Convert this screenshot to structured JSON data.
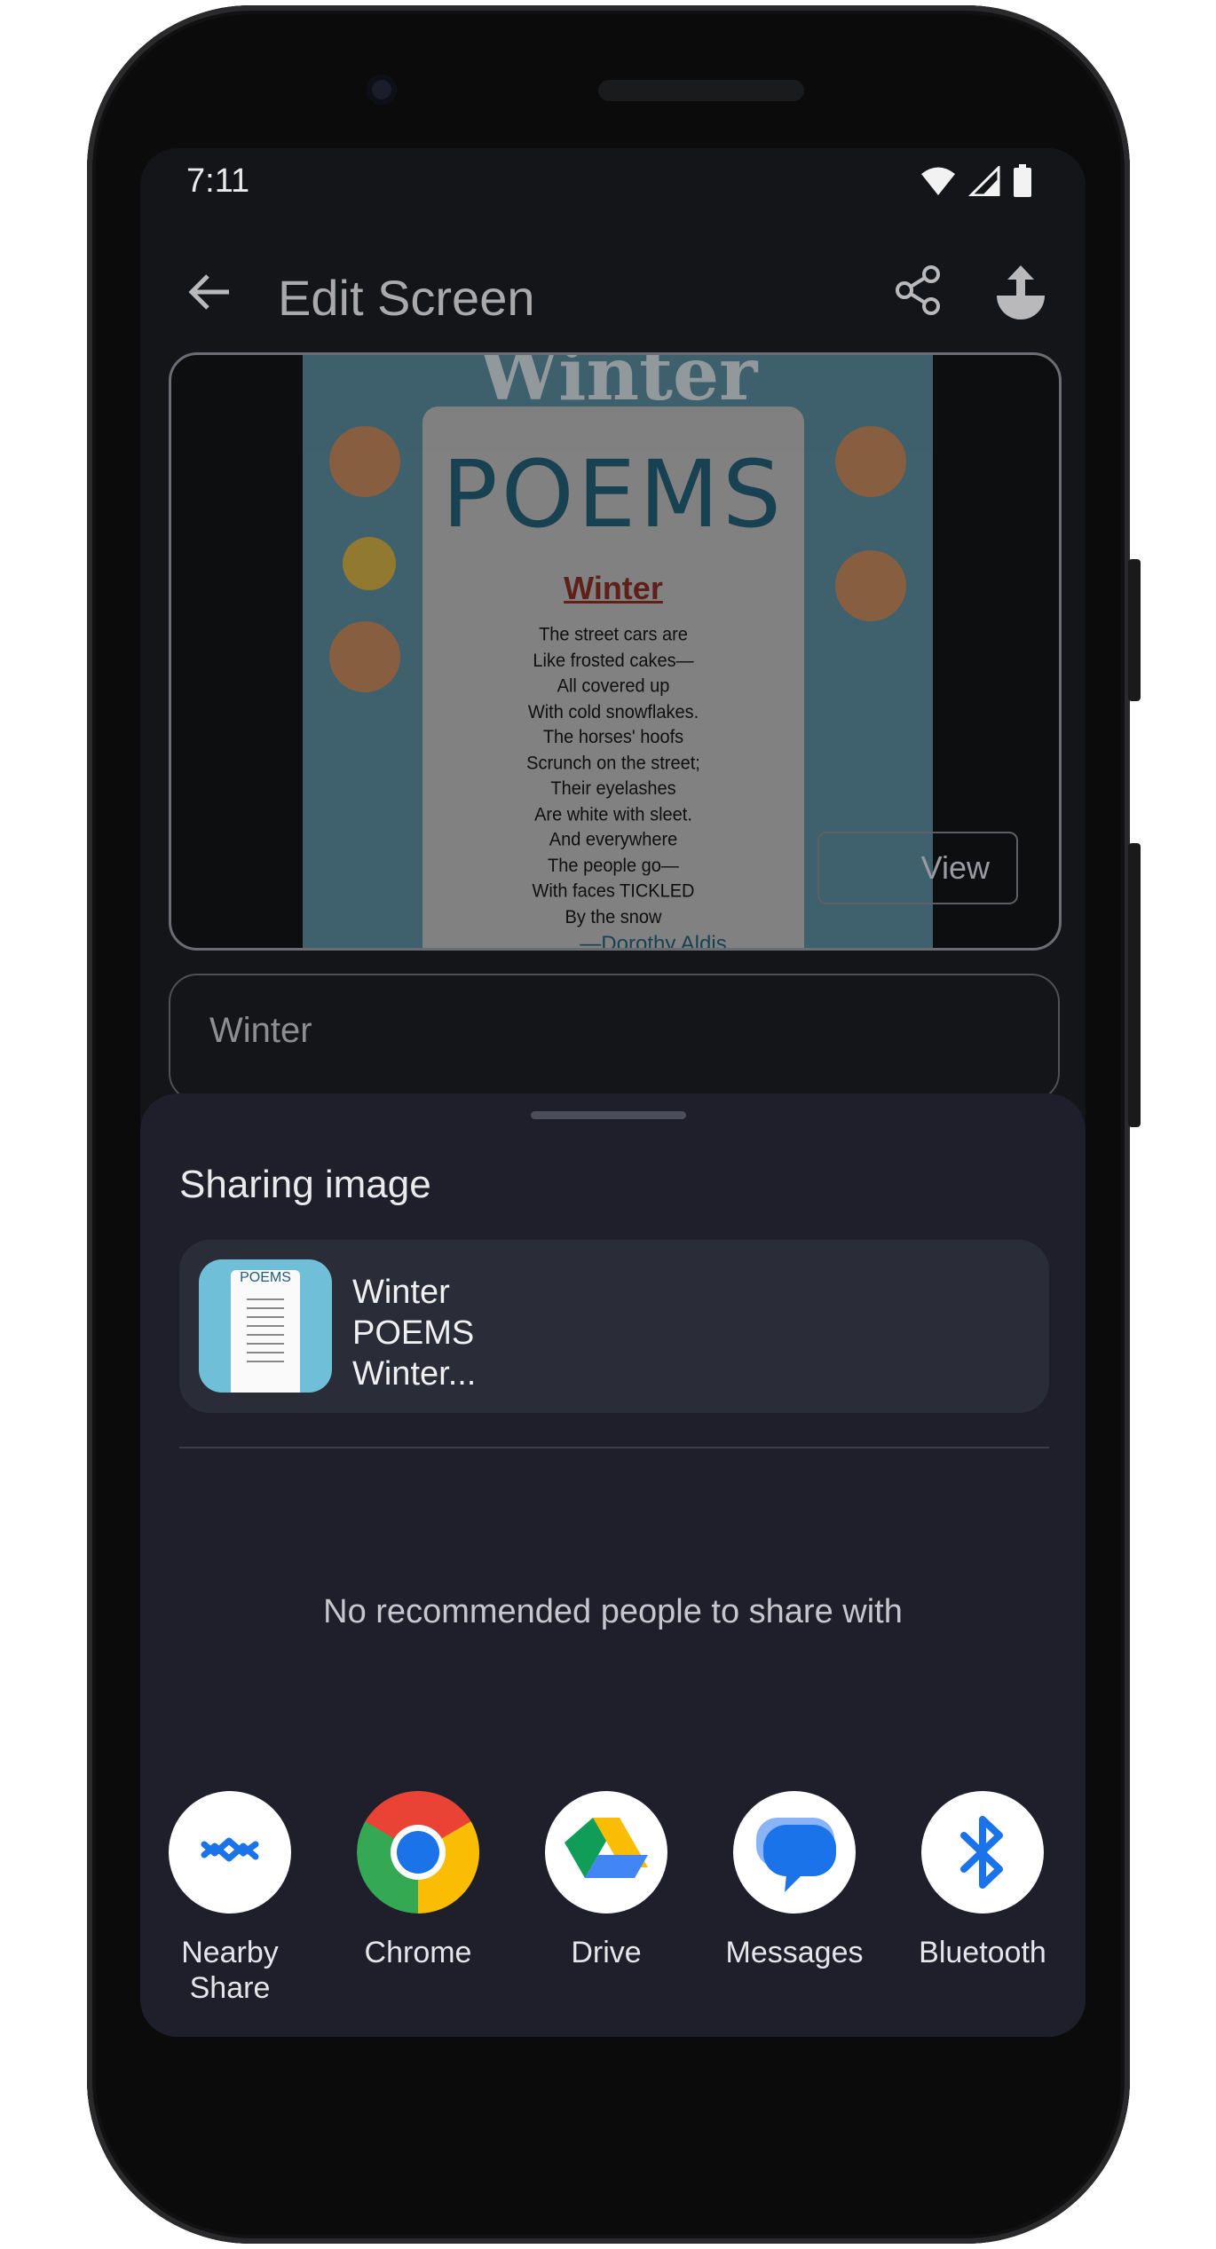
{
  "status_bar": {
    "time": "7:11"
  },
  "app_bar": {
    "title": "Edit Screen"
  },
  "preview": {
    "poster_title_top": "Winter",
    "poster_title_main": "POEMS",
    "poem_title": "Winter",
    "poem_lines": [
      "The street cars are",
      "Like frosted cakes—",
      "All covered up",
      "With cold snowflakes.",
      "The horses' hoofs",
      "Scrunch on the street;",
      "Their eyelashes",
      "Are white with sleet.",
      "And everywhere",
      "The people go—",
      "With faces TICKLED",
      "By the snow"
    ],
    "poem_author": "—Dorothy Aldis",
    "view_button": "View"
  },
  "text_field": {
    "value": "Winter"
  },
  "share_sheet": {
    "title": "Sharing image",
    "item_text_line1": "Winter",
    "item_text_line2": "POEMS",
    "item_text_line3": "Winter...",
    "empty_people": "No recommended people to share with",
    "targets": [
      {
        "label": "Nearby Share",
        "icon": "nearby-share-icon"
      },
      {
        "label": "Chrome",
        "icon": "chrome-icon"
      },
      {
        "label": "Drive",
        "icon": "drive-icon"
      },
      {
        "label": "Messages",
        "icon": "messages-icon"
      },
      {
        "label": "Bluetooth",
        "icon": "bluetooth-icon"
      }
    ]
  },
  "colors": {
    "screen_bg": "#141518",
    "sheet_bg": "#1e1f2a",
    "card_bg": "#2a2c38",
    "accent_blue": "#1a73e8"
  }
}
